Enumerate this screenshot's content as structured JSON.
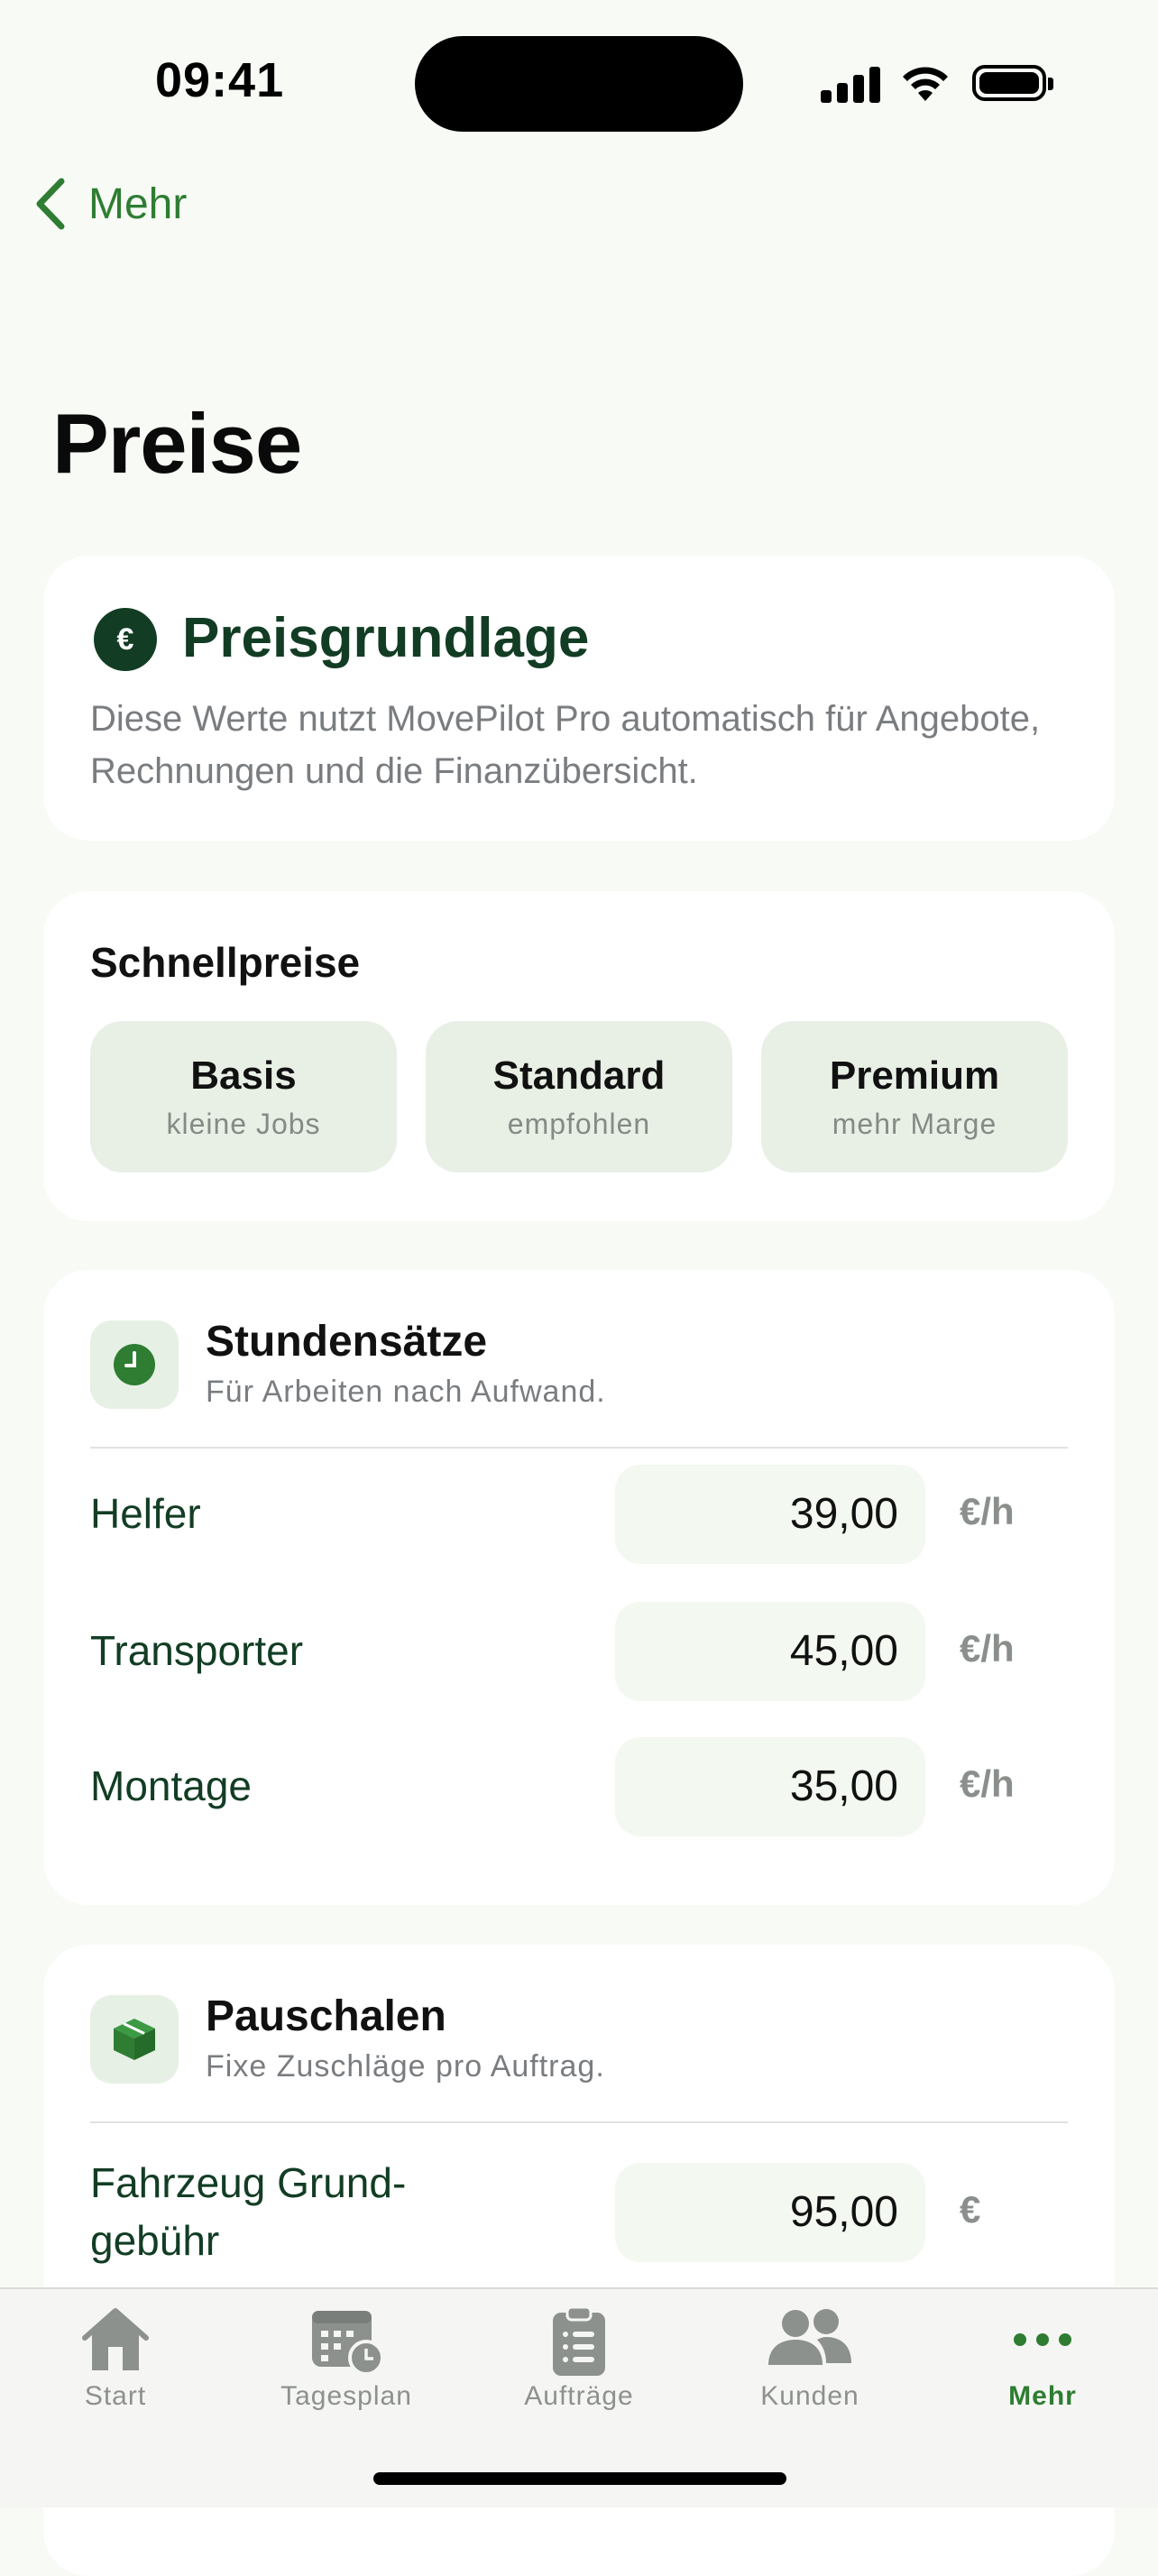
{
  "status_bar": {
    "time": "09:41"
  },
  "nav": {
    "back_label": "Mehr"
  },
  "page": {
    "title": "Preise"
  },
  "intro_card": {
    "icon_glyph": "€",
    "title": "Preisgrundlage",
    "description": "Diese Werte nutzt MovePilot Pro automatisch für Angebote, Rechnungen und die Finanzübersicht."
  },
  "quick_prices": {
    "title": "Schnellpreise",
    "tiers": [
      {
        "name": "Basis",
        "sub": "kleine Jobs"
      },
      {
        "name": "Standard",
        "sub": "empfohlen"
      },
      {
        "name": "Premium",
        "sub": "mehr Marge"
      }
    ]
  },
  "hourly": {
    "title": "Stundensätze",
    "subtitle": "Für Arbeiten nach Aufwand.",
    "rows": [
      {
        "label": "Helfer",
        "value": "39,00",
        "unit": "€/h"
      },
      {
        "label": "Transporter",
        "value": "45,00",
        "unit": "€/h"
      },
      {
        "label": "Montage",
        "value": "35,00",
        "unit": "€/h"
      }
    ]
  },
  "flat": {
    "title": "Pauschalen",
    "subtitle": "Fixe Zuschläge pro Auftrag.",
    "rows": [
      {
        "label": "Fahrzeug Grund-\ngebühr",
        "value": "95,00",
        "unit": "€"
      }
    ]
  },
  "tabbar": {
    "items": [
      {
        "label": "Start",
        "icon": "house-icon"
      },
      {
        "label": "Tagesplan",
        "icon": "calendar-clock-icon"
      },
      {
        "label": "Aufträge",
        "icon": "clipboard-list-icon"
      },
      {
        "label": "Kunden",
        "icon": "people-icon"
      },
      {
        "label": "Mehr",
        "icon": "more-dots-icon"
      }
    ],
    "active": "Mehr"
  },
  "colors": {
    "accent": "#2e7d32",
    "dark_green": "#123d24",
    "background": "#f7faf5"
  }
}
